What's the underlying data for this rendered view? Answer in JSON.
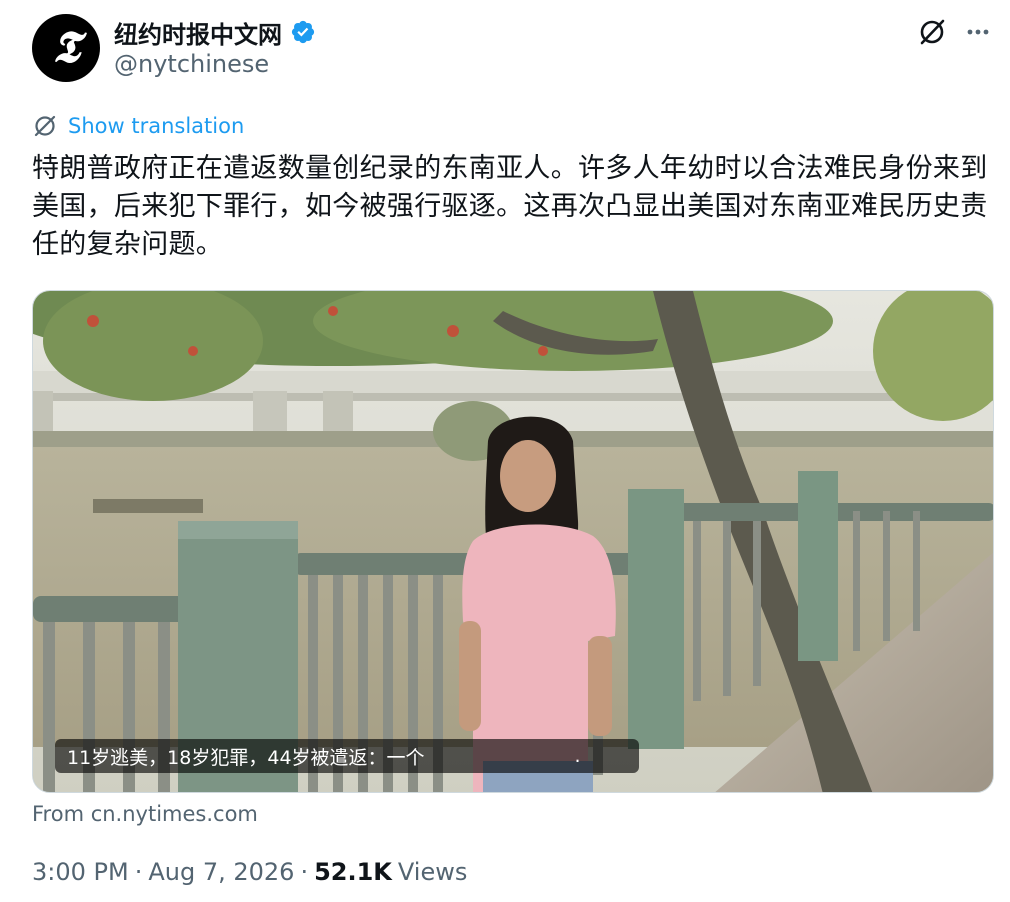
{
  "account": {
    "display_name": "纽约时报中文网",
    "handle": "@nytchinese",
    "avatar_glyph": "𝕿",
    "verified": true,
    "verified_color": "#1d9bf0"
  },
  "header_icons": {
    "grok": "grok-icon",
    "more": "more-icon"
  },
  "translation": {
    "label": "Show translation",
    "icon": "translate-icon",
    "color": "#1d9bf0"
  },
  "tweet": {
    "text": "特朗普政府正在遣返数量创纪录的东南亚人。许多人年幼时以合法难民身份来到美国，后来犯下罪行，如今被强行驱逐。这再次凸显出美国对东南亚难民历史责任的复杂问题。"
  },
  "media": {
    "caption": "11岁逃美，18岁犯罪，44岁被遣返：一个",
    "caption_end": "."
  },
  "link_source": "From cn.nytimes.com",
  "meta": {
    "time": "3:00 PM",
    "separator": "·",
    "date": "Aug 7, 2026",
    "views_count": "52.1K",
    "views_label": "Views"
  },
  "colors": {
    "text_primary": "#0f1419",
    "text_secondary": "#536471",
    "accent": "#1d9bf0"
  }
}
